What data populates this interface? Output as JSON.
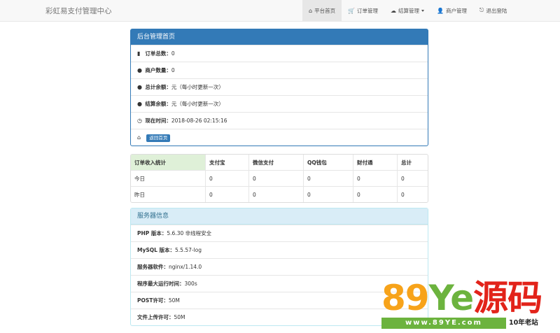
{
  "navbar": {
    "brand": "彩虹易支付管理中心",
    "items": [
      {
        "icon": "home-icon",
        "glyph": "⌂",
        "label": "平台首页",
        "active": true
      },
      {
        "icon": "cart-icon",
        "glyph": "🛒",
        "label": "订单管理",
        "active": false
      },
      {
        "icon": "cloud-icon",
        "glyph": "☁",
        "label": "结算管理",
        "active": false,
        "dropdown": true
      },
      {
        "icon": "user-icon",
        "glyph": "👤",
        "label": "商户管理",
        "active": false
      },
      {
        "icon": "logout-icon",
        "glyph": "⎋",
        "label": "退出登陆",
        "active": false
      }
    ]
  },
  "dashboard": {
    "title": "后台管理首页",
    "order_total_label": "订单总数：",
    "order_total_value": "0",
    "merchant_count_label": "商户数量：",
    "merchant_count_value": "0",
    "total_balance_label": "总计余额：",
    "total_balance_value": "元（每小时更新一次）",
    "settle_balance_label": "结算余额：",
    "settle_balance_value": "元（每小时更新一次）",
    "current_time_label": "现在时间：",
    "current_time_value": "2018-08-26 02:15:16",
    "back_button": "返回首页"
  },
  "stats": {
    "headers": [
      "订单收入统计",
      "支付宝",
      "微信支付",
      "QQ钱包",
      "财付通",
      "总计"
    ],
    "rows": [
      {
        "label": "今日",
        "values": [
          "0",
          "0",
          "0",
          "0",
          "0"
        ]
      },
      {
        "label": "昨日",
        "values": [
          "0",
          "0",
          "0",
          "0",
          "0"
        ]
      }
    ]
  },
  "server": {
    "title": "服务器信息",
    "php_label": "PHP 版本：",
    "php_value": "5.6.30 非线程安全",
    "mysql_label": "MySQL 版本：",
    "mysql_value": "5.5.57-log",
    "software_label": "服务器软件：",
    "software_value": "nginx/1.14.0",
    "max_exec_label": "程序最大运行时间：",
    "max_exec_value": "300s",
    "post_label": "POST许可：",
    "post_value": "50M",
    "upload_label": "文件上传许可：",
    "upload_value": "50M"
  },
  "watermark": {
    "logo_a": "89",
    "logo_b": "Ye",
    "logo_c": "源码",
    "url": "www.89YE.com",
    "tag": "10年老站"
  },
  "colors": {
    "primary": "#337ab7",
    "info_bg": "#d9edf7",
    "success_bg": "#dff0d8"
  }
}
